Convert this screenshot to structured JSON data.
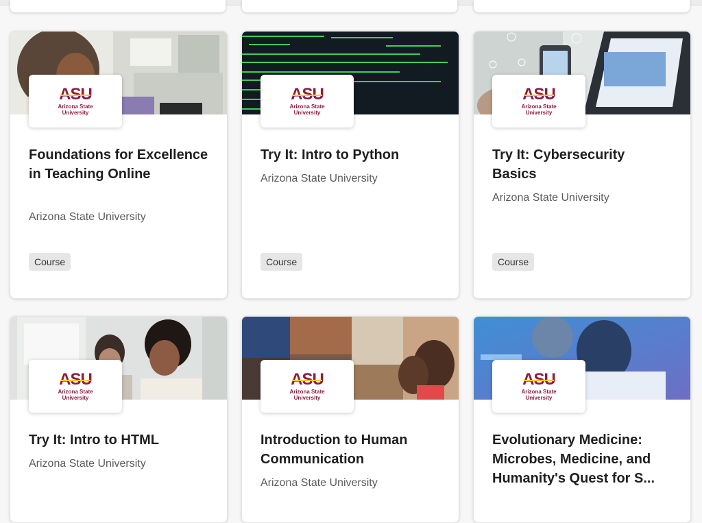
{
  "cards": [
    {
      "title": "Foundations for Excellence in Teaching Online",
      "partner": "Arizona State University",
      "tag": "Course",
      "logo": {
        "mark": "ASU",
        "name_line1": "Arizona State",
        "name_line2": "University"
      },
      "image": "woman-with-laptop-office"
    },
    {
      "title": "Try It: Intro to Python",
      "partner": "Arizona State University",
      "tag": "Course",
      "logo": {
        "mark": "ASU",
        "name_line1": "Arizona State",
        "name_line2": "University"
      },
      "image": "green-code-on-dark-screen"
    },
    {
      "title": "Try It: Cybersecurity Basics",
      "partner": "Arizona State University",
      "tag": "Course",
      "logo": {
        "mark": "ASU",
        "name_line1": "Arizona State",
        "name_line2": "University"
      },
      "image": "phone-and-laptop-network"
    },
    {
      "title": "Try It: Intro to HTML",
      "partner": "Arizona State University",
      "logo": {
        "mark": "ASU",
        "name_line1": "Arizona State",
        "name_line2": "University"
      },
      "image": "women-at-computer"
    },
    {
      "title": "Introduction to Human Communication",
      "partner": "Arizona State University",
      "logo": {
        "mark": "ASU",
        "name_line1": "Arizona State",
        "name_line2": "University"
      },
      "image": "photo-collage-people"
    },
    {
      "title": "Evolutionary Medicine: Microbes, Medicine, and Humanity's Quest for S...",
      "logo": {
        "mark": "ASU",
        "name_line1": "Arizona State",
        "name_line2": "University"
      },
      "image": "scientist-blue-lab"
    }
  ]
}
